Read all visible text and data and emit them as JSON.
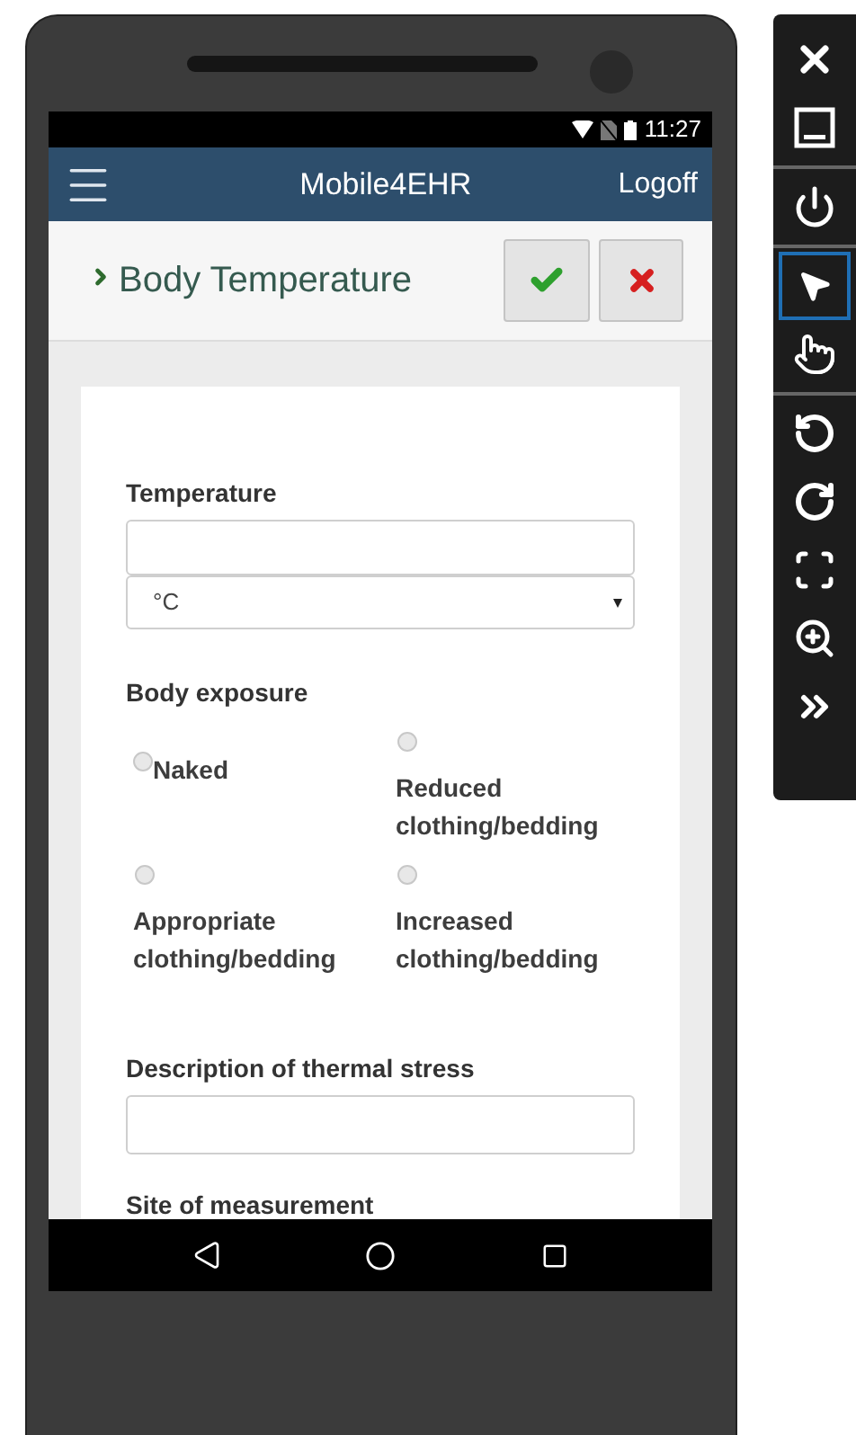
{
  "status_bar": {
    "time": "11:27"
  },
  "app_bar": {
    "title": "Mobile4EHR",
    "logoff": "Logoff"
  },
  "header": {
    "title": "Body Temperature"
  },
  "form": {
    "temperature": {
      "label": "Temperature",
      "unit": "°C"
    },
    "body_exposure": {
      "label": "Body exposure",
      "options": [
        {
          "label": "Naked",
          "kind": "inline",
          "selected": false
        },
        {
          "label": "Reduced clothing/bedding",
          "kind": "stacked",
          "selected": false
        },
        {
          "label": "Appropriate clothing/bedding",
          "kind": "stacked",
          "selected": false
        },
        {
          "label": "Increased clothing/bedding",
          "kind": "stacked",
          "selected": false
        }
      ]
    },
    "thermal_stress": {
      "label": "Description of thermal stress"
    },
    "site": {
      "label": "Site of measurement"
    }
  },
  "toolbar": [
    {
      "kind": "close",
      "selected": false
    },
    {
      "kind": "minimize",
      "selected": false
    },
    {
      "kind": "power",
      "selected": false
    },
    {
      "kind": "pointer",
      "selected": true
    },
    {
      "kind": "touch",
      "selected": false
    },
    {
      "kind": "rotate-left",
      "selected": false
    },
    {
      "kind": "rotate-right",
      "selected": false
    },
    {
      "kind": "screenshot",
      "selected": false
    },
    {
      "kind": "zoom",
      "selected": false
    },
    {
      "kind": "more",
      "selected": false
    }
  ]
}
